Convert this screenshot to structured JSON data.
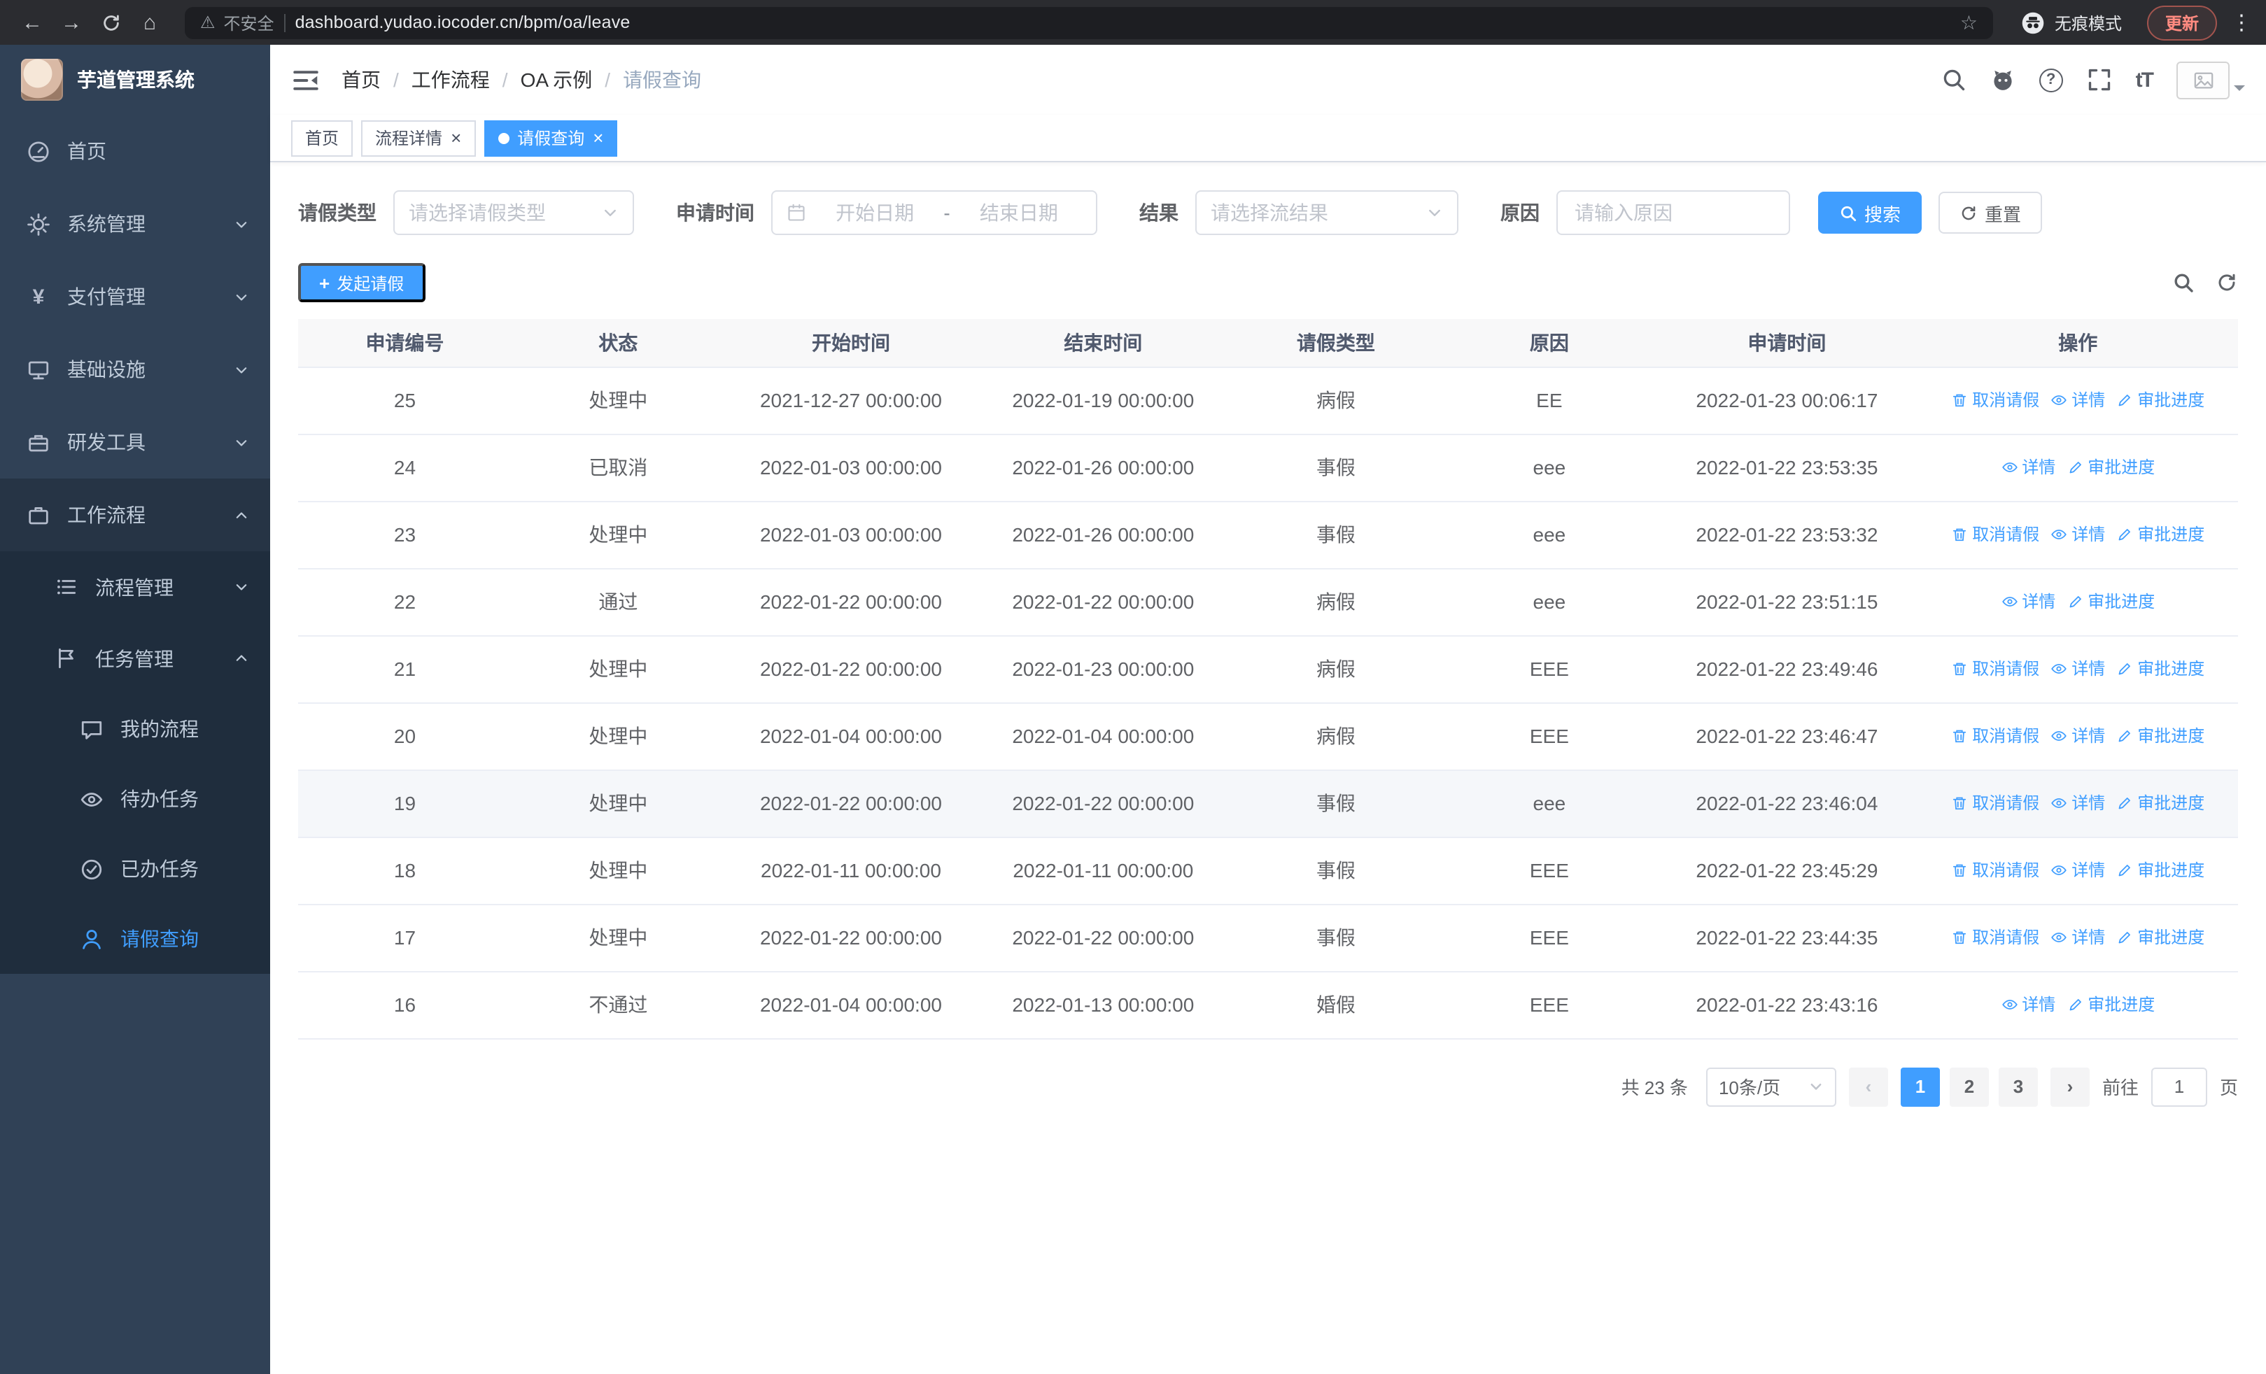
{
  "theme": {
    "primary": "#409EFF",
    "sidebar_bg": "#304156",
    "sidebar_sub_bg": "#1f2d3d"
  },
  "icons": {
    "back": "←",
    "forward": "→",
    "home": "⌂",
    "warning": "⚠",
    "star": "☆",
    "more": "⋮",
    "yen": "¥",
    "font_size": "tT",
    "help": "?",
    "plus": "+",
    "close": "×",
    "breadcrumb_separator": "/",
    "date_separator": "-",
    "prev": "‹",
    "next": "›"
  },
  "browser": {
    "security_label": "不安全",
    "url": "dashboard.yudao.iocoder.cn/bpm/oa/leave",
    "incognito_label": "无痕模式",
    "update_label": "更新"
  },
  "sidebar": {
    "app_title": "芋道管理系统",
    "menu": [
      {
        "label": "首页"
      },
      {
        "label": "系统管理"
      },
      {
        "label": "支付管理"
      },
      {
        "label": "基础设施"
      },
      {
        "label": "研发工具"
      },
      {
        "label": "工作流程"
      },
      {
        "label": "流程管理"
      },
      {
        "label": "任务管理"
      },
      {
        "label": "我的流程"
      },
      {
        "label": "待办任务"
      },
      {
        "label": "已办任务"
      },
      {
        "label": "请假查询"
      }
    ]
  },
  "header": {
    "breadcrumb": [
      "首页",
      "工作流程",
      "OA 示例",
      "请假查询"
    ]
  },
  "tabs": [
    {
      "label": "首页"
    },
    {
      "label": "流程详情"
    },
    {
      "label": "请假查询"
    }
  ],
  "filters": {
    "leave_type_label": "请假类型",
    "leave_type_placeholder": "请选择请假类型",
    "apply_time_label": "申请时间",
    "start_placeholder": "开始日期",
    "end_placeholder": "结束日期",
    "result_label": "结果",
    "result_placeholder": "请选择流结果",
    "reason_label": "原因",
    "reason_placeholder": "请输入原因",
    "search_label": "搜索",
    "reset_label": "重置"
  },
  "toolbar": {
    "create_label": "发起请假"
  },
  "table": {
    "columns": [
      "申请编号",
      "状态",
      "开始时间",
      "结束时间",
      "请假类型",
      "原因",
      "申请时间",
      "操作"
    ],
    "actions": {
      "cancel": "取消请假",
      "detail": "详情",
      "progress": "审批进度"
    },
    "rows": [
      {
        "id": "25",
        "status": "处理中",
        "start": "2021-12-27 00:00:00",
        "end": "2022-01-19 00:00:00",
        "type": "病假",
        "reason": "EE",
        "applied": "2022-01-23 00:06:17"
      },
      {
        "id": "24",
        "status": "已取消",
        "start": "2022-01-03 00:00:00",
        "end": "2022-01-26 00:00:00",
        "type": "事假",
        "reason": "eee",
        "applied": "2022-01-22 23:53:35"
      },
      {
        "id": "23",
        "status": "处理中",
        "start": "2022-01-03 00:00:00",
        "end": "2022-01-26 00:00:00",
        "type": "事假",
        "reason": "eee",
        "applied": "2022-01-22 23:53:32"
      },
      {
        "id": "22",
        "status": "通过",
        "start": "2022-01-22 00:00:00",
        "end": "2022-01-22 00:00:00",
        "type": "病假",
        "reason": "eee",
        "applied": "2022-01-22 23:51:15"
      },
      {
        "id": "21",
        "status": "处理中",
        "start": "2022-01-22 00:00:00",
        "end": "2022-01-23 00:00:00",
        "type": "病假",
        "reason": "EEE",
        "applied": "2022-01-22 23:49:46"
      },
      {
        "id": "20",
        "status": "处理中",
        "start": "2022-01-04 00:00:00",
        "end": "2022-01-04 00:00:00",
        "type": "病假",
        "reason": "EEE",
        "applied": "2022-01-22 23:46:47"
      },
      {
        "id": "19",
        "status": "处理中",
        "start": "2022-01-22 00:00:00",
        "end": "2022-01-22 00:00:00",
        "type": "事假",
        "reason": "eee",
        "applied": "2022-01-22 23:46:04"
      },
      {
        "id": "18",
        "status": "处理中",
        "start": "2022-01-11 00:00:00",
        "end": "2022-01-11 00:00:00",
        "type": "事假",
        "reason": "EEE",
        "applied": "2022-01-22 23:45:29"
      },
      {
        "id": "17",
        "status": "处理中",
        "start": "2022-01-22 00:00:00",
        "end": "2022-01-22 00:00:00",
        "type": "事假",
        "reason": "EEE",
        "applied": "2022-01-22 23:44:35"
      },
      {
        "id": "16",
        "status": "不通过",
        "start": "2022-01-04 00:00:00",
        "end": "2022-01-13 00:00:00",
        "type": "婚假",
        "reason": "EEE",
        "applied": "2022-01-22 23:43:16"
      }
    ]
  },
  "pagination": {
    "total_label": "共 23 条",
    "page_size_label": "10条/页",
    "pages": [
      "1",
      "2",
      "3"
    ],
    "goto_label": "前往",
    "goto_value": "1",
    "page_unit": "页"
  }
}
